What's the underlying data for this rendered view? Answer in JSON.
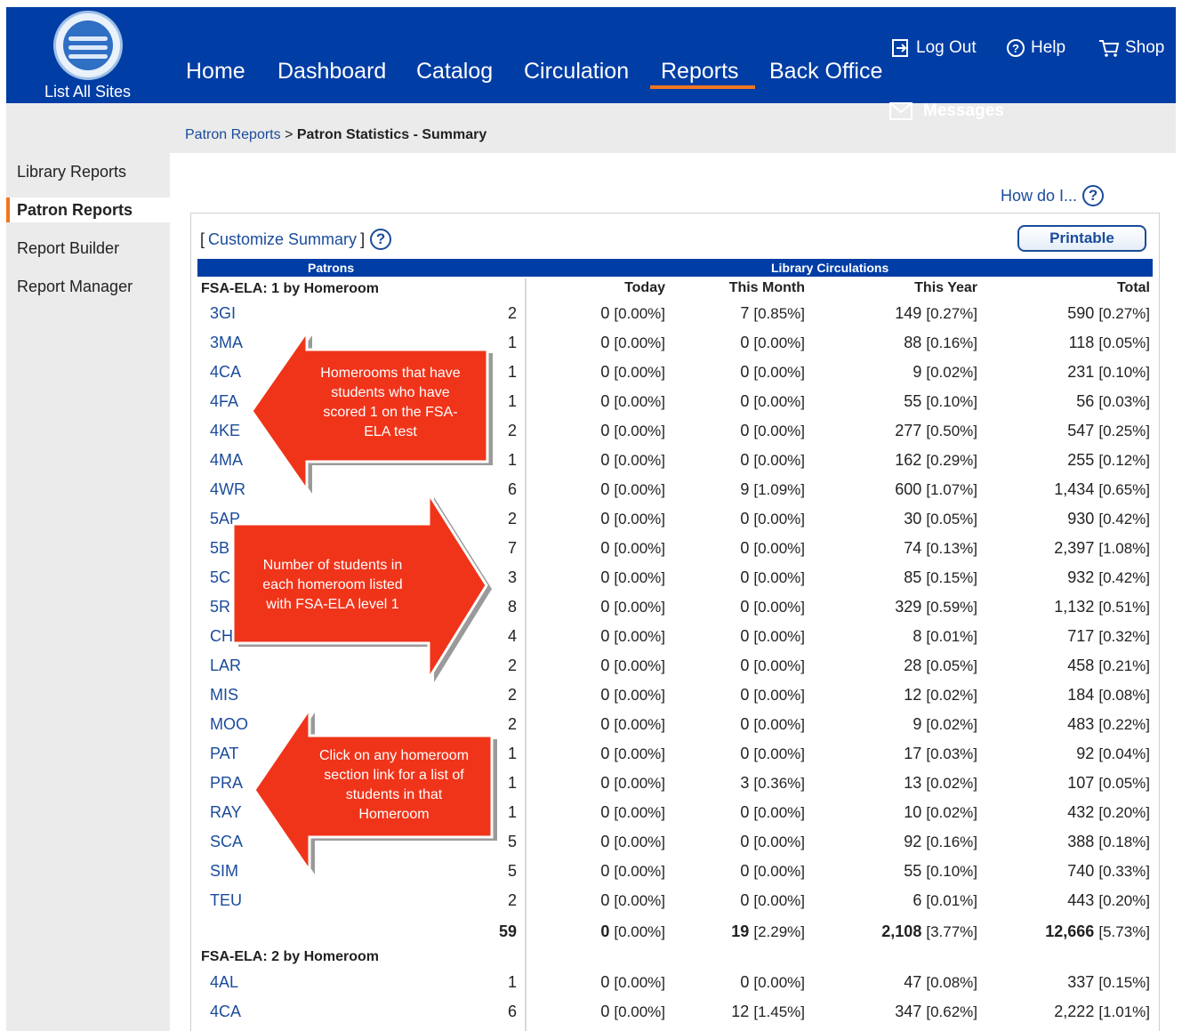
{
  "header": {
    "logo_label": "List All Sites",
    "nav": [
      "Home",
      "Dashboard",
      "Catalog",
      "Circulation",
      "Reports",
      "Back Office"
    ],
    "active_nav": "Reports",
    "logout_label": "Log Out",
    "help_label": "Help",
    "shop_label": "Shop",
    "messages_label": "Messages",
    "accent_color": "#f07622",
    "brand_color": "#003da5"
  },
  "breadcrumb": {
    "parent": "Patron Reports",
    "separator": ">",
    "current": "Patron Statistics - Summary"
  },
  "sidebar": {
    "items": [
      "Library Reports",
      "Patron Reports",
      "Report Builder",
      "Report Manager"
    ],
    "active": "Patron Reports"
  },
  "help": {
    "how_do_i": "How do I...",
    "question_mark": "?"
  },
  "toolbar": {
    "customize_open": "[",
    "customize_label": "Customize Summary",
    "customize_close": "]",
    "printable_label": "Printable"
  },
  "table": {
    "patrons_header": "Patrons",
    "circ_header": "Library Circulations",
    "columns": [
      "Today",
      "This Month",
      "This Year",
      "Total"
    ],
    "groups": [
      {
        "label": "FSA-ELA: 1 by Homeroom",
        "rows": [
          {
            "name": "3GI",
            "count": "2",
            "today": "0",
            "today_pct": "[0.00%]",
            "month": "7",
            "month_pct": "[0.85%]",
            "year": "149",
            "year_pct": "[0.27%]",
            "total": "590",
            "total_pct": "[0.27%]"
          },
          {
            "name": "3MA",
            "count": "1",
            "today": "0",
            "today_pct": "[0.00%]",
            "month": "0",
            "month_pct": "[0.00%]",
            "year": "88",
            "year_pct": "[0.16%]",
            "total": "118",
            "total_pct": "[0.05%]"
          },
          {
            "name": "4CA",
            "count": "1",
            "today": "0",
            "today_pct": "[0.00%]",
            "month": "0",
            "month_pct": "[0.00%]",
            "year": "9",
            "year_pct": "[0.02%]",
            "total": "231",
            "total_pct": "[0.10%]"
          },
          {
            "name": "4FA",
            "count": "1",
            "today": "0",
            "today_pct": "[0.00%]",
            "month": "0",
            "month_pct": "[0.00%]",
            "year": "55",
            "year_pct": "[0.10%]",
            "total": "56",
            "total_pct": "[0.03%]"
          },
          {
            "name": "4KE",
            "count": "2",
            "today": "0",
            "today_pct": "[0.00%]",
            "month": "0",
            "month_pct": "[0.00%]",
            "year": "277",
            "year_pct": "[0.50%]",
            "total": "547",
            "total_pct": "[0.25%]"
          },
          {
            "name": "4MA",
            "count": "1",
            "today": "0",
            "today_pct": "[0.00%]",
            "month": "0",
            "month_pct": "[0.00%]",
            "year": "162",
            "year_pct": "[0.29%]",
            "total": "255",
            "total_pct": "[0.12%]"
          },
          {
            "name": "4WR",
            "count": "6",
            "today": "0",
            "today_pct": "[0.00%]",
            "month": "9",
            "month_pct": "[1.09%]",
            "year": "600",
            "year_pct": "[1.07%]",
            "total": "1,434",
            "total_pct": "[0.65%]"
          },
          {
            "name": "5AP",
            "count": "2",
            "today": "0",
            "today_pct": "[0.00%]",
            "month": "0",
            "month_pct": "[0.00%]",
            "year": "30",
            "year_pct": "[0.05%]",
            "total": "930",
            "total_pct": "[0.42%]"
          },
          {
            "name": "5B",
            "count": "7",
            "today": "0",
            "today_pct": "[0.00%]",
            "month": "0",
            "month_pct": "[0.00%]",
            "year": "74",
            "year_pct": "[0.13%]",
            "total": "2,397",
            "total_pct": "[1.08%]"
          },
          {
            "name": "5C",
            "count": "3",
            "today": "0",
            "today_pct": "[0.00%]",
            "month": "0",
            "month_pct": "[0.00%]",
            "year": "85",
            "year_pct": "[0.15%]",
            "total": "932",
            "total_pct": "[0.42%]"
          },
          {
            "name": "5R",
            "count": "8",
            "today": "0",
            "today_pct": "[0.00%]",
            "month": "0",
            "month_pct": "[0.00%]",
            "year": "329",
            "year_pct": "[0.59%]",
            "total": "1,132",
            "total_pct": "[0.51%]"
          },
          {
            "name": "CH",
            "count": "4",
            "today": "0",
            "today_pct": "[0.00%]",
            "month": "0",
            "month_pct": "[0.00%]",
            "year": "8",
            "year_pct": "[0.01%]",
            "total": "717",
            "total_pct": "[0.32%]"
          },
          {
            "name": "LAR",
            "count": "2",
            "today": "0",
            "today_pct": "[0.00%]",
            "month": "0",
            "month_pct": "[0.00%]",
            "year": "28",
            "year_pct": "[0.05%]",
            "total": "458",
            "total_pct": "[0.21%]"
          },
          {
            "name": "MIS",
            "count": "2",
            "today": "0",
            "today_pct": "[0.00%]",
            "month": "0",
            "month_pct": "[0.00%]",
            "year": "12",
            "year_pct": "[0.02%]",
            "total": "184",
            "total_pct": "[0.08%]"
          },
          {
            "name": "MOO",
            "count": "2",
            "today": "0",
            "today_pct": "[0.00%]",
            "month": "0",
            "month_pct": "[0.00%]",
            "year": "9",
            "year_pct": "[0.02%]",
            "total": "483",
            "total_pct": "[0.22%]"
          },
          {
            "name": "PAT",
            "count": "1",
            "today": "0",
            "today_pct": "[0.00%]",
            "month": "0",
            "month_pct": "[0.00%]",
            "year": "17",
            "year_pct": "[0.03%]",
            "total": "92",
            "total_pct": "[0.04%]"
          },
          {
            "name": "PRA",
            "count": "1",
            "today": "0",
            "today_pct": "[0.00%]",
            "month": "3",
            "month_pct": "[0.36%]",
            "year": "13",
            "year_pct": "[0.02%]",
            "total": "107",
            "total_pct": "[0.05%]"
          },
          {
            "name": "RAY",
            "count": "1",
            "today": "0",
            "today_pct": "[0.00%]",
            "month": "0",
            "month_pct": "[0.00%]",
            "year": "10",
            "year_pct": "[0.02%]",
            "total": "432",
            "total_pct": "[0.20%]"
          },
          {
            "name": "SCA",
            "count": "5",
            "today": "0",
            "today_pct": "[0.00%]",
            "month": "0",
            "month_pct": "[0.00%]",
            "year": "92",
            "year_pct": "[0.16%]",
            "total": "388",
            "total_pct": "[0.18%]"
          },
          {
            "name": "SIM",
            "count": "5",
            "today": "0",
            "today_pct": "[0.00%]",
            "month": "0",
            "month_pct": "[0.00%]",
            "year": "55",
            "year_pct": "[0.10%]",
            "total": "740",
            "total_pct": "[0.33%]"
          },
          {
            "name": "TEU",
            "count": "2",
            "today": "0",
            "today_pct": "[0.00%]",
            "month": "0",
            "month_pct": "[0.00%]",
            "year": "6",
            "year_pct": "[0.01%]",
            "total": "443",
            "total_pct": "[0.20%]"
          }
        ],
        "totals": {
          "count": "59",
          "today": "0",
          "today_pct": "[0.00%]",
          "month": "19",
          "month_pct": "[2.29%]",
          "year": "2,108",
          "year_pct": "[3.77%]",
          "total": "12,666",
          "total_pct": "[5.73%]"
        }
      },
      {
        "label": "FSA-ELA: 2 by Homeroom",
        "rows": [
          {
            "name": "4AL",
            "count": "1",
            "today": "0",
            "today_pct": "[0.00%]",
            "month": "0",
            "month_pct": "[0.00%]",
            "year": "47",
            "year_pct": "[0.08%]",
            "total": "337",
            "total_pct": "[0.15%]"
          },
          {
            "name": "4CA",
            "count": "6",
            "today": "0",
            "today_pct": "[0.00%]",
            "month": "12",
            "month_pct": "[1.45%]",
            "year": "347",
            "year_pct": "[0.62%]",
            "total": "2,222",
            "total_pct": "[1.01%]"
          }
        ]
      }
    ]
  },
  "callouts": {
    "color": "#f0341a",
    "homerooms": [
      "Homerooms that have",
      "students who have",
      "scored  1 on the FSA-",
      "ELA test"
    ],
    "counts": [
      "Number of students in",
      "each homeroom listed",
      "with FSA-ELA level 1"
    ],
    "click": [
      "Click on any homeroom",
      "section link for a list of",
      "students in that",
      "Homeroom"
    ]
  }
}
